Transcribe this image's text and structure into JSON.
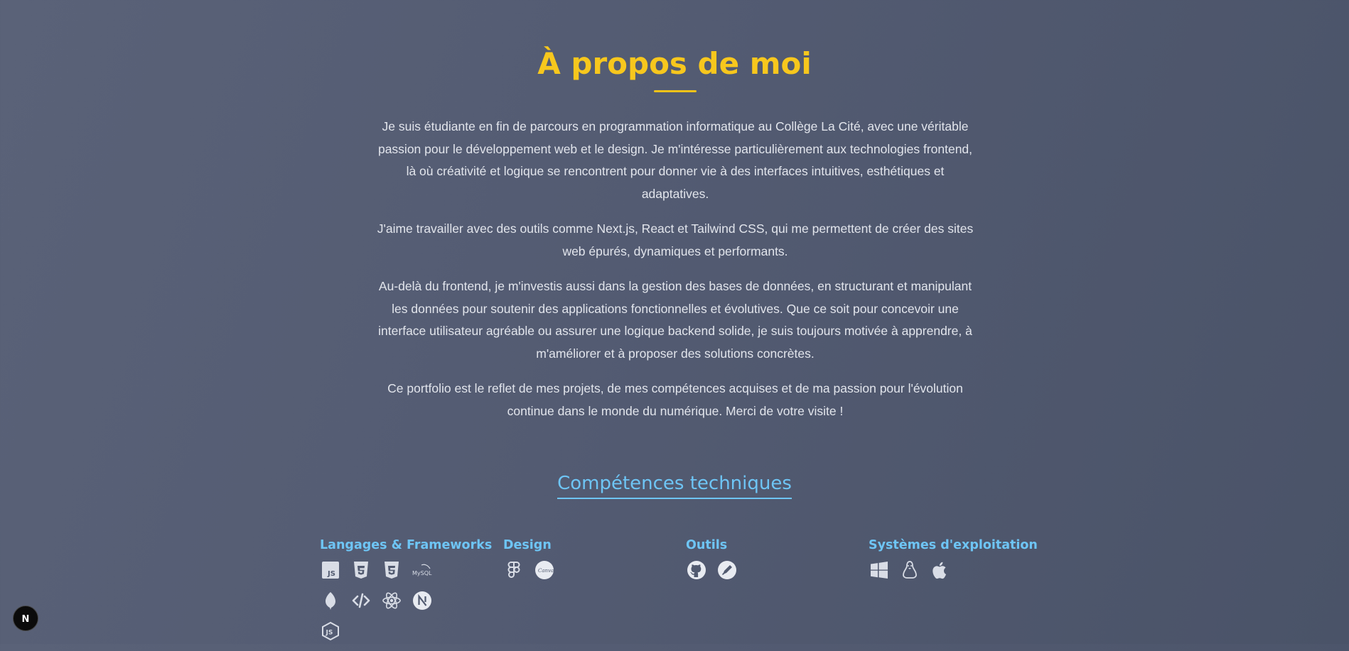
{
  "about": {
    "title": "À propos de moi",
    "paragraphs": [
      "Je suis étudiante en fin de parcours en programmation informatique au Collège La Cité, avec une véritable passion pour le développement web et le design. Je m'intéresse particulièrement aux technologies frontend, là où créativité et logique se rencontrent pour donner vie à des interfaces intuitives, esthétiques et adaptatives.",
      "J'aime travailler avec des outils comme Next.js, React et Tailwind CSS, qui me permettent de créer des sites web épurés, dynamiques et performants.",
      "Au-delà du frontend, je m'investis aussi dans la gestion des bases de données, en structurant et manipulant les données pour soutenir des applications fonctionnelles et évolutives. Que ce soit pour concevoir une interface utilisateur agréable ou assurer une logique backend solide, je suis toujours motivée à apprendre, à m'améliorer et à proposer des solutions concrètes.",
      "Ce portfolio est le reflet de mes projets, de mes compétences acquises et de ma passion pour l'évolution continue dans le monde du numérique. Merci de votre visite !"
    ]
  },
  "skills": {
    "title": "Compétences techniques",
    "categories": [
      {
        "title": "Langages & Frameworks",
        "icons": [
          "javascript-icon",
          "html5-icon",
          "css3-icon",
          "mysql-icon",
          "mongodb-icon",
          "code-icon",
          "react-icon",
          "nextjs-icon",
          "nodejs-icon"
        ]
      },
      {
        "title": "Design",
        "icons": [
          "figma-icon",
          "canva-icon"
        ]
      },
      {
        "title": "Outils",
        "icons": [
          "github-icon",
          "pen-tool-icon"
        ]
      },
      {
        "title": "Systèmes d'exploitation",
        "icons": [
          "windows-icon",
          "linux-icon",
          "apple-icon"
        ]
      }
    ]
  },
  "icon_labels": {
    "mysql": "MySQL",
    "canva": "Canva",
    "js": "JS"
  },
  "badge": {
    "letter": "N"
  },
  "colors": {
    "accent_yellow": "#f7c71d",
    "accent_blue": "#6ec5f5",
    "text": "#e2e5ec"
  }
}
